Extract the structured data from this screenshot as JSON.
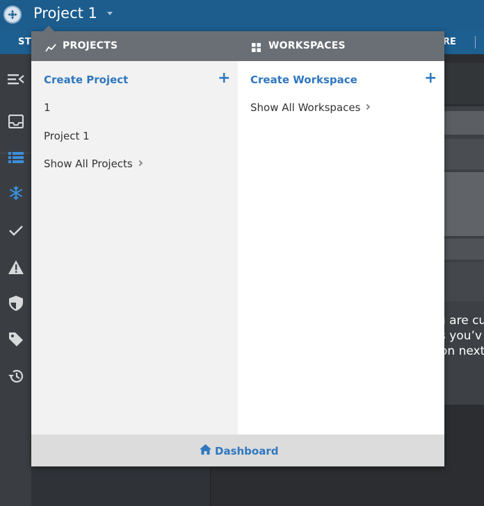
{
  "header": {
    "project_title": "Project 1",
    "nav_left_label": "STO",
    "nav_right_label": "RE"
  },
  "background": {
    "text_lines": [
      "u are cu",
      "s you’v",
      "on next"
    ]
  },
  "dropdown": {
    "projects": {
      "heading": "PROJECTS",
      "create_label": "Create Project",
      "items": [
        "1",
        "Project 1"
      ],
      "show_all_label": "Show All Projects"
    },
    "workspaces": {
      "heading": "WORKSPACES",
      "create_label": "Create Workspace",
      "show_all_label": "Show All Workspaces"
    },
    "footer_label": "Dashboard"
  },
  "icons": {
    "rail": [
      "collapse-menu-icon",
      "inbox-icon",
      "list-icon",
      "snowflake-icon",
      "check-icon",
      "warning-icon",
      "shield-icon",
      "tag-icon",
      "history-icon"
    ],
    "accent": "#2f77bf"
  }
}
